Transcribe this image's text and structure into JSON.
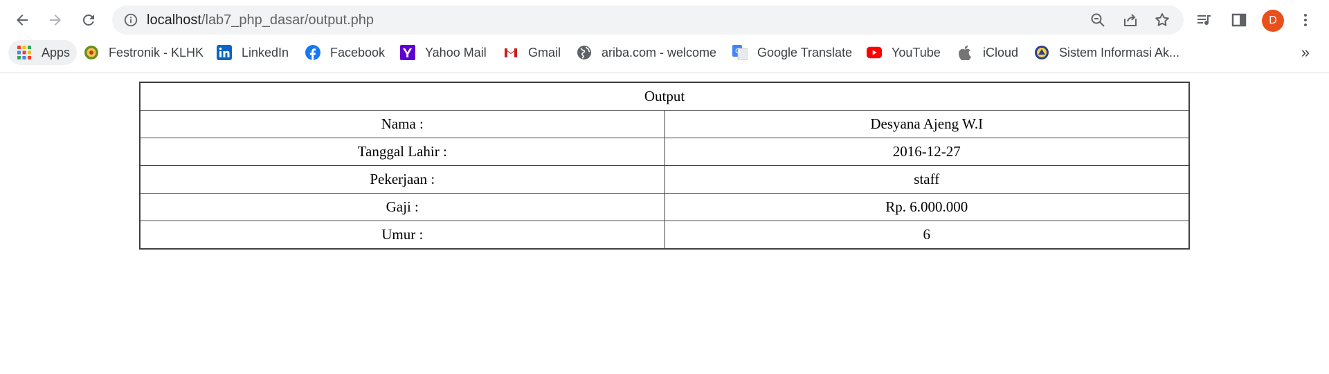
{
  "browser": {
    "url_host": "localhost",
    "url_path": "/lab7_php_dasar/output.php",
    "profile_initial": "D",
    "accent_profile": "#e8501c",
    "bookmarks": [
      {
        "label": "Apps",
        "icon": "apps-grid-icon"
      },
      {
        "label": "Festronik - KLHK",
        "icon": "klhk-logo-icon"
      },
      {
        "label": "LinkedIn",
        "icon": "linkedin-icon"
      },
      {
        "label": "Facebook",
        "icon": "facebook-icon"
      },
      {
        "label": "Yahoo Mail",
        "icon": "yahoo-icon"
      },
      {
        "label": "Gmail",
        "icon": "gmail-icon"
      },
      {
        "label": "ariba.com - welcome",
        "icon": "globe-icon"
      },
      {
        "label": "Google Translate",
        "icon": "google-translate-icon"
      },
      {
        "label": "YouTube",
        "icon": "youtube-icon"
      },
      {
        "label": "iCloud",
        "icon": "apple-icon"
      },
      {
        "label": "Sistem Informasi Ak...",
        "icon": "university-seal-icon"
      }
    ],
    "more_bookmarks": "»"
  },
  "page": {
    "table_title": "Output",
    "rows": [
      {
        "label": "Nama :",
        "value": "Desyana Ajeng W.I"
      },
      {
        "label": "Tanggal Lahir :",
        "value": "2016-12-27"
      },
      {
        "label": "Pekerjaan :",
        "value": "staff"
      },
      {
        "label": "Gaji :",
        "value": "Rp. 6.000.000"
      },
      {
        "label": "Umur :",
        "value": "6"
      }
    ]
  }
}
